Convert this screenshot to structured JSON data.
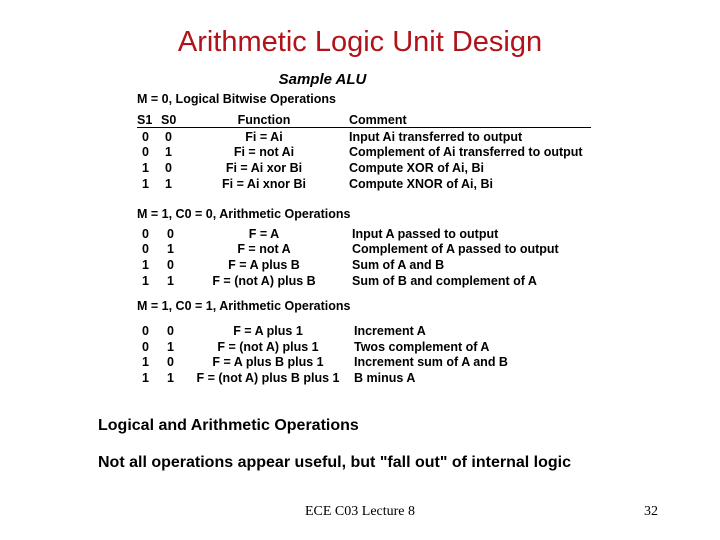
{
  "slide": {
    "title": "Arithmetic Logic Unit Design",
    "subtitle": "Sample ALU",
    "footer": "ECE C03 Lecture 8",
    "page_number": "32",
    "title_color": "#b0131a"
  },
  "table": {
    "headers": {
      "s1": "S1",
      "s0": "S0",
      "function": "Function",
      "comment": "Comment"
    },
    "sections": [
      {
        "label": "M = 0, Logical Bitwise Operations",
        "rows": [
          {
            "s1": "0",
            "s0": "0",
            "function": "Fi = Ai",
            "comment": "Input Ai transferred to output"
          },
          {
            "s1": "0",
            "s0": "1",
            "function": "Fi = not Ai",
            "comment": "Complement of Ai transferred to output"
          },
          {
            "s1": "1",
            "s0": "0",
            "function": "Fi = Ai xor Bi",
            "comment": "Compute XOR of Ai, Bi"
          },
          {
            "s1": "1",
            "s0": "1",
            "function": "Fi = Ai xnor Bi",
            "comment": "Compute XNOR of Ai, Bi"
          }
        ]
      },
      {
        "label": "M = 1, C0 = 0, Arithmetic Operations",
        "rows": [
          {
            "s1": "0",
            "s0": "0",
            "function": "F = A",
            "comment": "Input A passed to output"
          },
          {
            "s1": "0",
            "s0": "1",
            "function": "F = not A",
            "comment": "Complement of A passed to output"
          },
          {
            "s1": "1",
            "s0": "0",
            "function": "F = A plus B",
            "comment": "Sum of A and B"
          },
          {
            "s1": "1",
            "s0": "1",
            "function": "F = (not A) plus B",
            "comment": "Sum of B and complement of A"
          }
        ]
      },
      {
        "label": "M = 1, C0 = 1, Arithmetic Operations",
        "rows": [
          {
            "s1": "0",
            "s0": "0",
            "function": "F = A plus 1",
            "comment": "Increment A"
          },
          {
            "s1": "0",
            "s0": "1",
            "function": "F = (not A) plus 1",
            "comment": "Twos complement of A"
          },
          {
            "s1": "1",
            "s0": "0",
            "function": "F = A plus B plus 1",
            "comment": "Increment sum of A and B"
          },
          {
            "s1": "1",
            "s0": "1",
            "function": "F = (not A) plus B plus 1",
            "comment": "B minus A"
          }
        ]
      }
    ]
  },
  "body": {
    "line1": "Logical and Arithmetic Operations",
    "line2": "Not all operations appear useful, but \"fall out\" of internal logic"
  }
}
